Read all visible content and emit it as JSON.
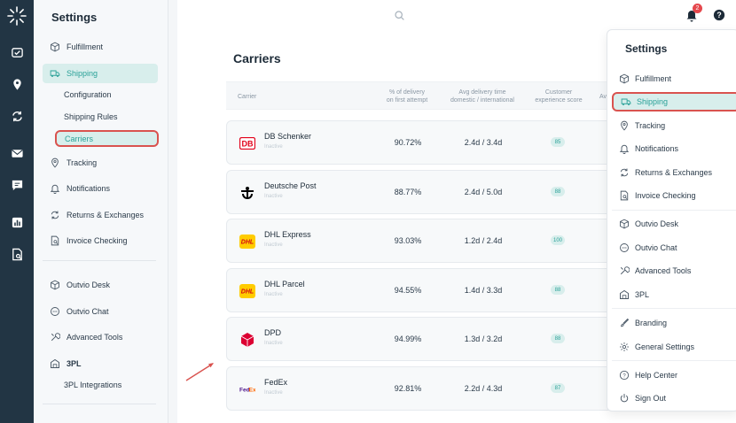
{
  "sidebar": {
    "title": "Settings",
    "items": [
      {
        "label": "Fulfillment",
        "icon": "box-icon"
      },
      {
        "label": "Shipping",
        "icon": "truck-icon",
        "active": true
      },
      {
        "label": "Tracking",
        "icon": "location-pin-icon"
      },
      {
        "label": "Notifications",
        "icon": "bell-icon"
      },
      {
        "label": "Returns & Exchanges",
        "icon": "refresh-icon"
      },
      {
        "label": "Invoice Checking",
        "icon": "invoice-search-icon"
      },
      {
        "label": "Outvio Desk",
        "icon": "desk-icon"
      },
      {
        "label": "Outvio Chat",
        "icon": "chat-icon"
      },
      {
        "label": "Advanced Tools",
        "icon": "tools-icon"
      },
      {
        "label": "3PL",
        "icon": "warehouse-icon"
      }
    ],
    "shipping_subitems": [
      "Configuration",
      "Shipping Rules",
      "Carriers"
    ],
    "tpl_subitems": [
      "3PL Integrations"
    ]
  },
  "topbar": {
    "notification_count": "2"
  },
  "main": {
    "title": "Carriers",
    "columns": {
      "carrier": "Carrier",
      "delivery_pct_line1": "% of delivery",
      "delivery_pct_line2": "on first attempt",
      "avg_time_line1": "Avg delivery time",
      "avg_time_line2": "domestic / international",
      "score_line1": "Customer",
      "score_line2": "experience score",
      "cutoff": "Av"
    },
    "carriers": [
      {
        "name": "DB Schenker",
        "status": "Inactive",
        "pct": "90.72%",
        "time": "2.4d / 3.4d",
        "score": "85",
        "logo": "db-schenker-logo"
      },
      {
        "name": "Deutsche Post",
        "status": "Inactive",
        "pct": "88.77%",
        "time": "2.4d / 5.0d",
        "score": "88",
        "logo": "deutsche-post-logo"
      },
      {
        "name": "DHL Express",
        "status": "Inactive",
        "pct": "93.03%",
        "time": "1.2d / 2.4d",
        "score": "100",
        "logo": "dhl-logo"
      },
      {
        "name": "DHL Parcel",
        "status": "Inactive",
        "pct": "94.55%",
        "time": "1.4d / 3.3d",
        "score": "88",
        "logo": "dhl-logo"
      },
      {
        "name": "DPD",
        "status": "Inactive",
        "pct": "94.99%",
        "time": "1.3d / 3.2d",
        "score": "88",
        "logo": "dpd-logo"
      },
      {
        "name": "FedEx",
        "status": "Inactive",
        "pct": "92.81%",
        "time": "2.2d / 4.3d",
        "score": "87",
        "logo": "fedex-logo"
      }
    ]
  },
  "menu": {
    "title": "Settings",
    "items": [
      {
        "label": "Fulfillment",
        "icon": "box-icon"
      },
      {
        "label": "Shipping",
        "icon": "truck-icon",
        "active": true
      },
      {
        "label": "Tracking",
        "icon": "location-pin-icon"
      },
      {
        "label": "Notifications",
        "icon": "bell-icon"
      },
      {
        "label": "Returns & Exchanges",
        "icon": "refresh-icon"
      },
      {
        "label": "Invoice Checking",
        "icon": "invoice-search-icon"
      },
      {
        "label": "Outvio Desk",
        "icon": "desk-icon"
      },
      {
        "label": "Outvio Chat",
        "icon": "chat-icon"
      },
      {
        "label": "Advanced Tools",
        "icon": "tools-icon"
      },
      {
        "label": "3PL",
        "icon": "warehouse-icon"
      },
      {
        "label": "Branding",
        "icon": "brush-icon"
      },
      {
        "label": "General Settings",
        "icon": "gear-icon"
      },
      {
        "label": "Help Center",
        "icon": "help-circle-icon"
      },
      {
        "label": "Sign Out",
        "icon": "power-icon"
      }
    ]
  },
  "colors": {
    "rail": "#223544",
    "accent": "#2aa198",
    "accent_bg": "#d8eeec",
    "highlight": "#d9534f",
    "badge": "#e5484d"
  }
}
